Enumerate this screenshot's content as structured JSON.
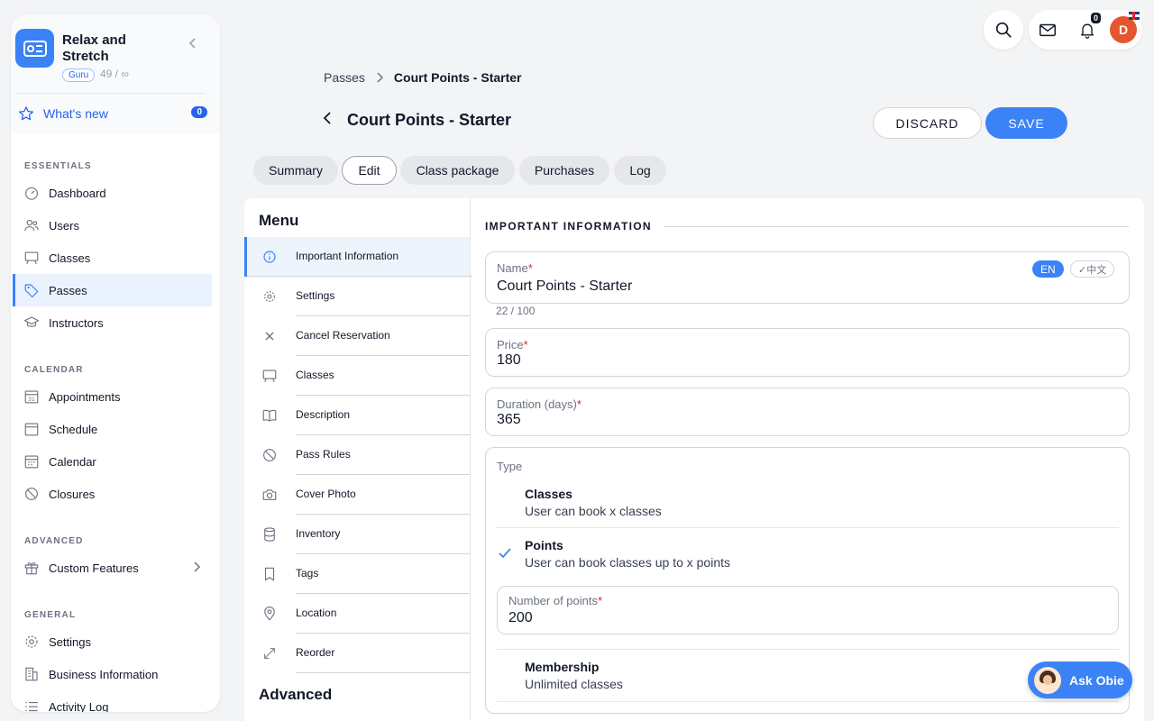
{
  "brand": {
    "name": "Relax and Stretch",
    "badge": "Guru",
    "count": "49 / ∞"
  },
  "whats_new": {
    "label": "What's new",
    "count": "0"
  },
  "sidebar": {
    "sections": [
      {
        "title": "ESSENTIALS",
        "items": [
          {
            "label": "Dashboard",
            "icon": "dashboard-icon"
          },
          {
            "label": "Users",
            "icon": "users-icon"
          },
          {
            "label": "Classes",
            "icon": "classes-icon"
          },
          {
            "label": "Passes",
            "icon": "tag-icon",
            "active": true
          },
          {
            "label": "Instructors",
            "icon": "graduation-cap-icon"
          }
        ]
      },
      {
        "title": "CALENDAR",
        "items": [
          {
            "label": "Appointments",
            "icon": "calendar-31-icon"
          },
          {
            "label": "Schedule",
            "icon": "calendar-icon"
          },
          {
            "label": "Calendar",
            "icon": "calendar-grid-icon"
          },
          {
            "label": "Closures",
            "icon": "ban-icon"
          }
        ]
      },
      {
        "title": "ADVANCED",
        "items": [
          {
            "label": "Custom Features",
            "icon": "gift-icon"
          }
        ]
      },
      {
        "title": "GENERAL",
        "items": [
          {
            "label": "Settings",
            "icon": "gear-icon"
          },
          {
            "label": "Business Information",
            "icon": "building-icon"
          },
          {
            "label": "Activity Log",
            "icon": "list-icon"
          }
        ]
      }
    ]
  },
  "topbar": {
    "notifications_count": "0",
    "avatar_initial": "D"
  },
  "breadcrumb": {
    "parent": "Passes",
    "current": "Court Points - Starter"
  },
  "header": {
    "title": "Court Points - Starter",
    "discard_label": "DISCARD",
    "save_label": "SAVE"
  },
  "tabs": [
    "Summary",
    "Edit",
    "Class package",
    "Purchases",
    "Log"
  ],
  "active_tab": "Edit",
  "menu": {
    "title": "Menu",
    "items": [
      {
        "label": "Important Information",
        "icon": "info-icon"
      },
      {
        "label": "Settings",
        "icon": "gear-icon"
      },
      {
        "label": "Cancel Reservation",
        "icon": "x-icon"
      },
      {
        "label": "Classes",
        "icon": "classes-icon"
      },
      {
        "label": "Description",
        "icon": "book-icon"
      },
      {
        "label": "Pass Rules",
        "icon": "ban-icon"
      },
      {
        "label": "Cover Photo",
        "icon": "camera-icon"
      },
      {
        "label": "Inventory",
        "icon": "database-icon"
      },
      {
        "label": "Tags",
        "icon": "bookmark-icon"
      },
      {
        "label": "Location",
        "icon": "location-pin-icon"
      },
      {
        "label": "Reorder",
        "icon": "expand-arrows-icon"
      }
    ],
    "advanced_title": "Advanced"
  },
  "form": {
    "section_title": "IMPORTANT INFORMATION",
    "name": {
      "label": "Name",
      "value": "Court Points - Starter",
      "count": "22 / 100",
      "lang_en": "EN",
      "lang_zh": "✓中文"
    },
    "price": {
      "label": "Price",
      "value": "180"
    },
    "duration": {
      "label": "Duration (days)",
      "value": "365"
    },
    "type": {
      "label": "Type",
      "options": [
        {
          "name": "Classes",
          "desc": "User can book x classes"
        },
        {
          "name": "Points",
          "desc": "User can book classes up to x points",
          "selected": true
        },
        {
          "name": "Membership",
          "desc": "Unlimited classes"
        }
      ],
      "points": {
        "label": "Number of points",
        "value": "200"
      }
    }
  },
  "ask_obie": {
    "label": "Ask Obie"
  }
}
